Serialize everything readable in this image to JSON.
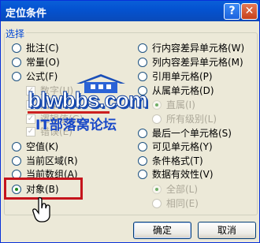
{
  "dialog": {
    "title": "定位条件",
    "help_label": "?",
    "close_label": "✕"
  },
  "group": {
    "label": "选择"
  },
  "left_options": [
    {
      "label": "批注(C)",
      "checked": false,
      "disabled": false
    },
    {
      "label": "常量(O)",
      "checked": false,
      "disabled": false
    },
    {
      "label": "公式(F)",
      "checked": false,
      "disabled": false
    },
    {
      "label": "数字(U)",
      "checked": true,
      "disabled": true
    },
    {
      "label": "文本(X)",
      "checked": true,
      "disabled": true
    },
    {
      "label": "逻辑值(G)",
      "checked": true,
      "disabled": true
    },
    {
      "label": "错误(E)",
      "checked": true,
      "disabled": true
    },
    {
      "label": "空值(K)",
      "checked": false,
      "disabled": false
    },
    {
      "label": "当前区域(R)",
      "checked": false,
      "disabled": false
    },
    {
      "label": "当前数组(A)",
      "checked": false,
      "disabled": false
    },
    {
      "label": "对象(B)",
      "checked": true,
      "disabled": false
    }
  ],
  "right_options": [
    {
      "label": "行内容差异单元格(W)",
      "checked": false,
      "disabled": false
    },
    {
      "label": "列内容差异单元格(M)",
      "checked": false,
      "disabled": false
    },
    {
      "label": "引用单元格(P)",
      "checked": false,
      "disabled": false
    },
    {
      "label": "从属单元格(D)",
      "checked": false,
      "disabled": false
    },
    {
      "label": "直属(I)",
      "checked": true,
      "disabled": true
    },
    {
      "label": "所有级别(L)",
      "checked": false,
      "disabled": true
    },
    {
      "label": "最后一个单元格(S)",
      "checked": false,
      "disabled": false
    },
    {
      "label": "可见单元格(Y)",
      "checked": false,
      "disabled": false
    },
    {
      "label": "条件格式(T)",
      "checked": false,
      "disabled": false
    },
    {
      "label": "数据有效性(V)",
      "checked": false,
      "disabled": false
    },
    {
      "label": "全部(L)",
      "checked": true,
      "disabled": true
    },
    {
      "label": "相同(E)",
      "checked": false,
      "disabled": true
    }
  ],
  "watermark": {
    "url": "blwbbs.com",
    "tagline": "IT部落窝论坛"
  },
  "buttons": {
    "ok": "确定",
    "cancel": "取消"
  },
  "colors": {
    "title_bar": "#0453d1",
    "dialog_bg": "#ece9d8",
    "highlight_box": "#c5141c",
    "group_label": "#0046d5"
  }
}
